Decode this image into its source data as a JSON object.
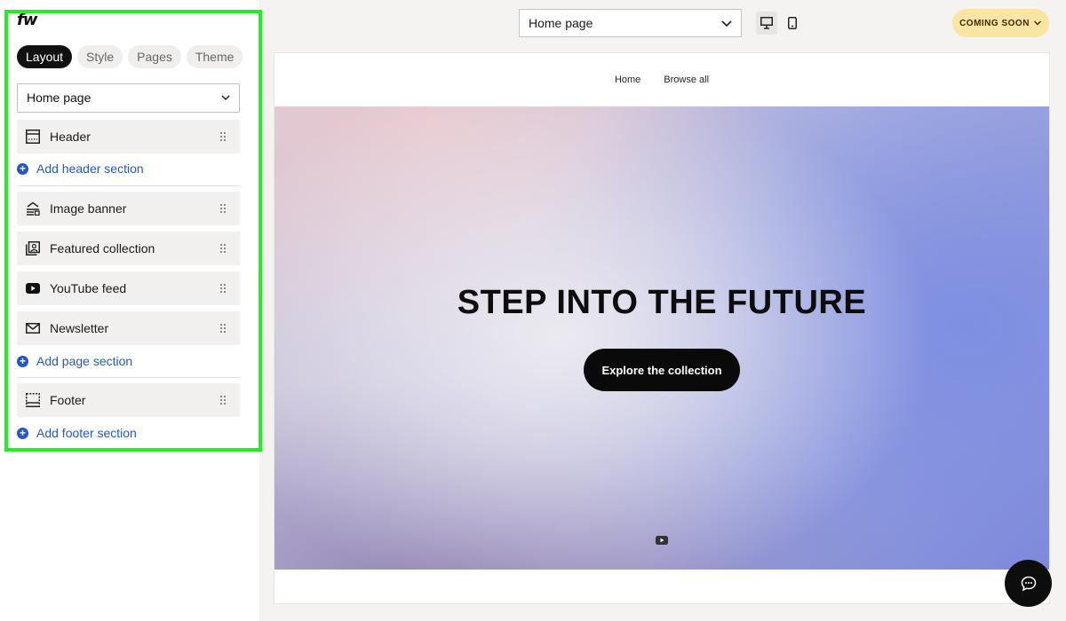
{
  "app": {
    "logo": "fw"
  },
  "sidebar": {
    "tabs": [
      "Layout",
      "Style",
      "Pages",
      "Theme"
    ],
    "page_select": "Home page",
    "sections": {
      "header": "Header",
      "image_banner": "Image banner",
      "featured_collection": "Featured collection",
      "youtube_feed": "YouTube feed",
      "newsletter": "Newsletter",
      "footer": "Footer"
    },
    "add_header": "Add header section",
    "add_page": "Add page section",
    "add_footer": "Add footer section"
  },
  "topbar": {
    "page_select": "Home page",
    "status_button": "COMING SOON",
    "icons": {
      "desktop": "desktop-icon",
      "mobile": "mobile-icon"
    }
  },
  "preview": {
    "nav": [
      "Home",
      "Browse all"
    ],
    "hero_title": "STEP INTO THE FUTURE",
    "hero_button": "Explore the collection"
  },
  "colors": {
    "accent": "#2457c5",
    "highlight": "#22ee22",
    "badge": "#fbe5a3"
  }
}
